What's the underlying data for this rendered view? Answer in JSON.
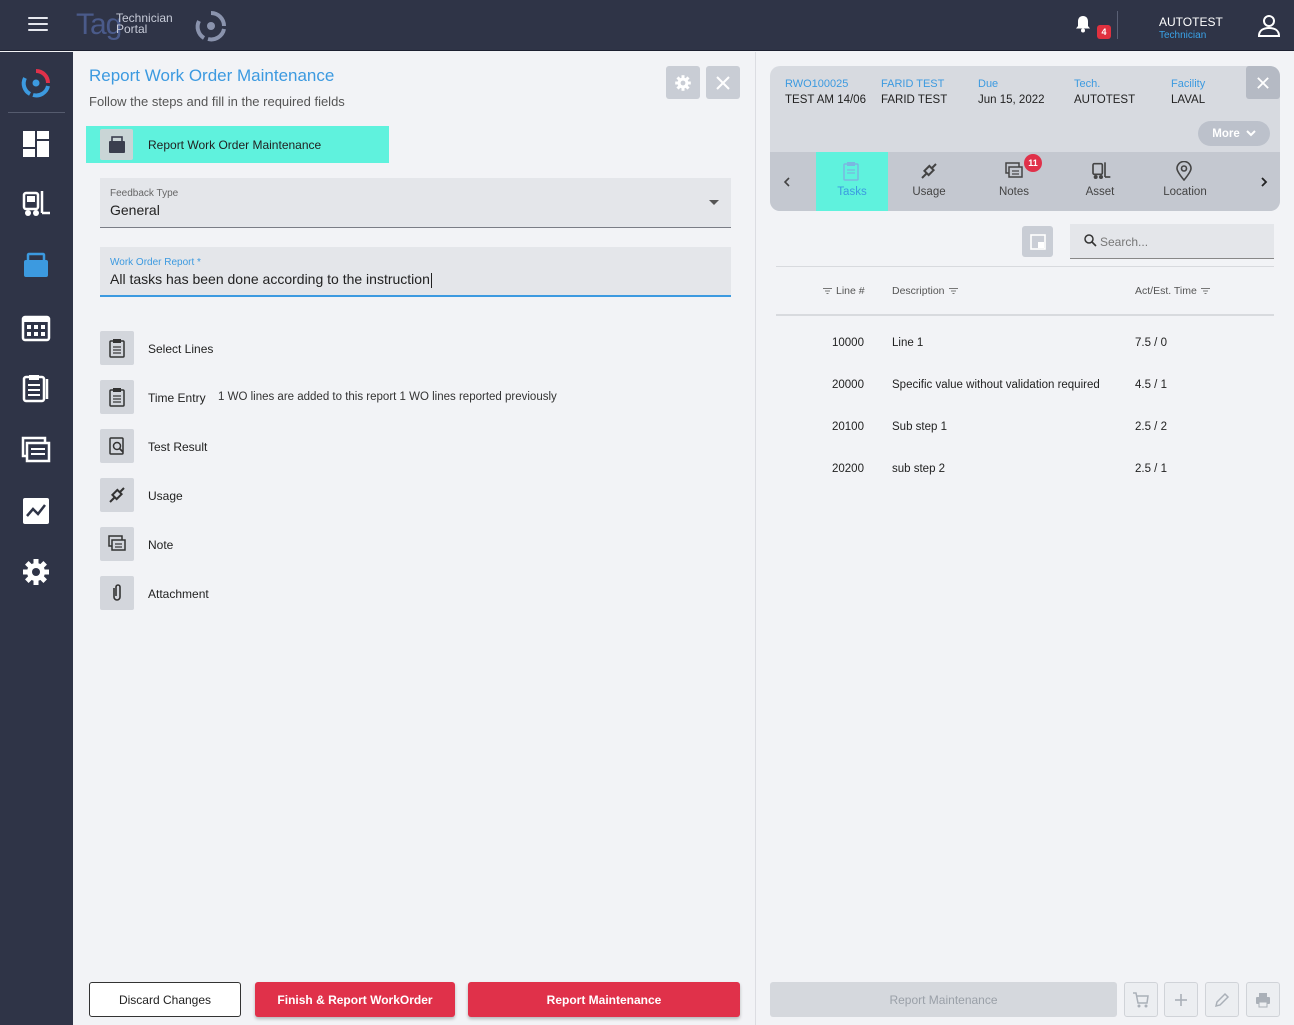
{
  "app": {
    "logo_brand": "Tag",
    "logo_line1": "Technician",
    "logo_line2": "Portal",
    "notification_count": "4",
    "user_name": "AUTOTEST",
    "user_role": "Technician"
  },
  "sidebar": {
    "items": [
      {
        "icon": "tag-logo-icon"
      },
      {
        "icon": "dashboard-icon"
      },
      {
        "icon": "forklift-icon"
      },
      {
        "icon": "work-order-icon"
      },
      {
        "icon": "calendar-icon"
      },
      {
        "icon": "checklist-icon"
      },
      {
        "icon": "documents-icon"
      },
      {
        "icon": "analytics-icon"
      },
      {
        "icon": "settings-icon"
      }
    ]
  },
  "form": {
    "title": "Report Work Order Maintenance",
    "subtitle": "Follow the steps and fill in the required fields",
    "current_step": "Report Work Order Maintenance",
    "feedback_type_label": "Feedback Type",
    "feedback_type_value": "General",
    "report_label": "Work Order Report *",
    "report_value": "All tasks has been done according to the instruction",
    "steps": [
      {
        "label": "Select Lines",
        "extra": ""
      },
      {
        "label": "Time Entry",
        "extra": "1 WO lines are added to this report 1 WO lines reported previously"
      },
      {
        "label": "Test Result",
        "extra": ""
      },
      {
        "label": "Usage",
        "extra": ""
      },
      {
        "label": "Note",
        "extra": ""
      },
      {
        "label": "Attachment",
        "extra": ""
      }
    ],
    "buttons": {
      "discard": "Discard Changes",
      "finish": "Finish & Report WorkOrder",
      "report": "Report Maintenance"
    }
  },
  "work_order": {
    "columns": [
      {
        "header": "RWO100025",
        "value": "TEST AM 14/06"
      },
      {
        "header": "FARID TEST",
        "value": "FARID TEST"
      },
      {
        "header": "Due",
        "value": "Jun 15, 2022"
      },
      {
        "header": "Tech.",
        "value": "AUTOTEST"
      },
      {
        "header": "Facility",
        "value": "LAVAL"
      }
    ],
    "more_label": "More",
    "tabs": [
      {
        "label": "Tasks",
        "active": true
      },
      {
        "label": "Usage",
        "active": false
      },
      {
        "label": "Notes",
        "active": false,
        "badge": "11"
      },
      {
        "label": "Asset",
        "active": false
      },
      {
        "label": "Location",
        "active": false
      }
    ],
    "search_placeholder": "Search...",
    "table": {
      "headers": [
        "Line #",
        "Description",
        "Act/Est. Time"
      ],
      "rows": [
        {
          "line": "10000",
          "description": "Line 1",
          "time": "7.5 / 0"
        },
        {
          "line": "20000",
          "description": "Specific value without validation required",
          "time": "4.5 / 1"
        },
        {
          "line": "20100",
          "description": "Sub step 1",
          "time": "2.5 / 2"
        },
        {
          "line": "20200",
          "description": "sub step 2",
          "time": "2.5 / 1"
        }
      ]
    },
    "footer_button": "Report Maintenance"
  },
  "colors": {
    "accent": "#3c9ae0",
    "danger": "#e0314a",
    "highlight": "#5ff2dd",
    "nav_bg": "#2f3447"
  }
}
